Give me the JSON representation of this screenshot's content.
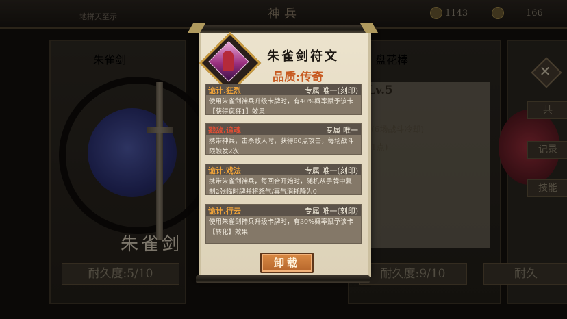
{
  "topbar": {
    "title": "神兵",
    "subtitle": "地拼天至示",
    "currency_1": "1143",
    "currency_2": "166"
  },
  "left_card": {
    "header": "朱雀剑",
    "weapon_name": "朱雀剑",
    "durability": "耐久度:5/10"
  },
  "right_card": {
    "header": "盘花棒",
    "level": "Lv.5",
    "info_1": "牌(6场战斗冷却)",
    "info_2": "复1点)",
    "durability": "耐久度:9/10"
  },
  "far_right": {
    "durability": "耐久",
    "btn_1": "共",
    "btn_2": "记录",
    "btn_3": "技能"
  },
  "modal": {
    "title": "朱雀剑符文",
    "quality": "品质:传奇",
    "runes": [
      {
        "name": "诡计.狂烈",
        "tag": "专属  唯一(刻印)",
        "desc": "使用朱雀剑神兵升级卡牌时，有40%概率赋予该卡【获得疯狂1】效果"
      },
      {
        "name": "戮敌.追魂",
        "tag": "专属  唯一",
        "desc": "携带神兵，击杀敌人时，获得60点攻击，每场战斗限触发2次"
      },
      {
        "name": "诡计.戏法",
        "tag": "专属  唯一(刻印)",
        "desc": "携带朱雀剑神兵，每回合开始时，随机从手牌中复制2张临时牌并将怒气/真气消耗降为0"
      },
      {
        "name": "诡计.行云",
        "tag": "专属  唯一(刻印)",
        "desc": "使用朱雀剑神兵升级卡牌时，有30%概率赋予该卡【转化】效果"
      }
    ],
    "unload_label": "卸载"
  },
  "colors": {
    "rune_name": "#f0a43a",
    "rune_name_alt": "#e34e34",
    "quality": "#c75a21",
    "button": "#c8773a"
  },
  "icons": {
    "gem": "rune-gem-icon",
    "close": "close-icon",
    "currency": "coin-icon"
  }
}
